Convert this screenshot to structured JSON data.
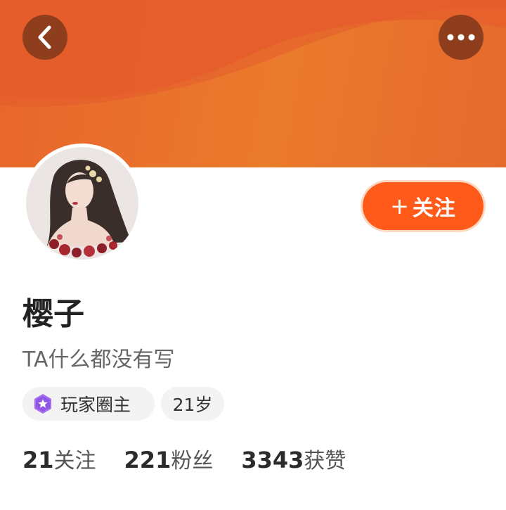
{
  "colors": {
    "header": "#e8702c",
    "follow_button": "#ff5a1a",
    "round_button": "#8e3d1d",
    "badge": "#a56cf0"
  },
  "icons": {
    "back": "chevron-left-icon",
    "more": "more-dots-icon",
    "badge": "star-badge-icon"
  },
  "profile": {
    "follow_label": "关注",
    "follow_plus": "+",
    "username": "樱子",
    "bio": "TA什么都没有写",
    "tags": {
      "role": "玩家圈主",
      "age": "21岁"
    }
  },
  "stats": [
    {
      "value": "21",
      "label": "关注"
    },
    {
      "value": "221",
      "label": "粉丝"
    },
    {
      "value": "3343",
      "label": "获赞"
    }
  ]
}
